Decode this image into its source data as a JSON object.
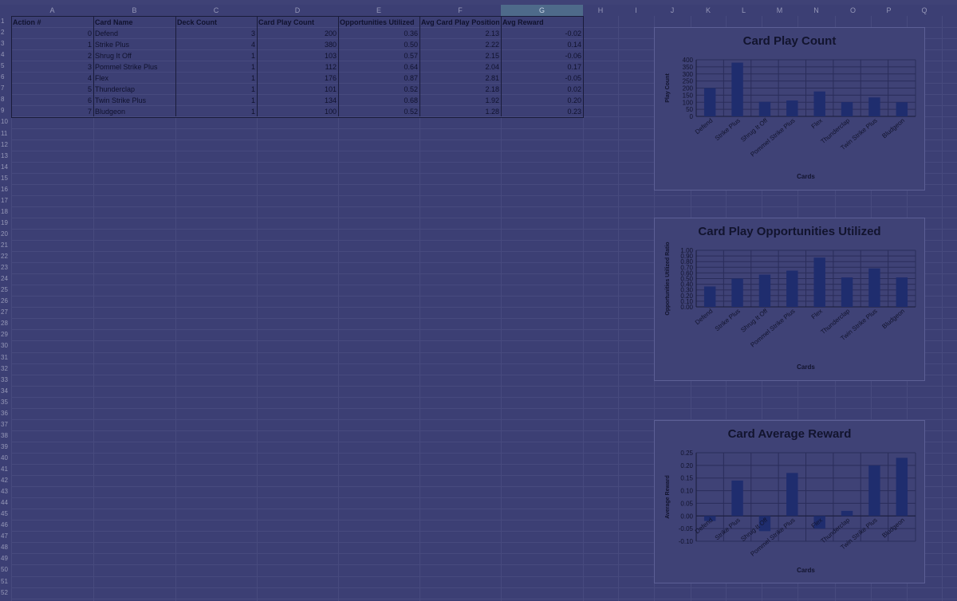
{
  "spreadsheet": {
    "columns": [
      "A",
      "B",
      "C",
      "D",
      "E",
      "F",
      "G",
      "H",
      "I",
      "J",
      "K",
      "L",
      "M",
      "N",
      "O",
      "P",
      "Q"
    ],
    "selected_column": "G",
    "rows": [
      "1",
      "2",
      "3",
      "4",
      "5",
      "6",
      "7",
      "8",
      "9",
      "10",
      "11",
      "12",
      "13",
      "14",
      "15",
      "16",
      "17",
      "18",
      "19",
      "20",
      "21",
      "22",
      "23",
      "24",
      "25",
      "26",
      "27",
      "28",
      "29",
      "30",
      "31",
      "32",
      "33",
      "34",
      "35",
      "36",
      "37",
      "38",
      "39",
      "40",
      "41",
      "42",
      "43",
      "44",
      "45",
      "46",
      "47",
      "48",
      "49",
      "50",
      "51",
      "52"
    ],
    "headers": [
      "Action #",
      "Card Name",
      "Deck Count",
      "Card Play Count",
      "Opportunities Utilized",
      "Avg Card Play Position",
      "Avg Reward"
    ],
    "data": [
      [
        "0",
        "Defend",
        "3",
        "200",
        "0.36",
        "2.13",
        "-0.02"
      ],
      [
        "1",
        "Strike Plus",
        "4",
        "380",
        "0.50",
        "2.22",
        "0.14"
      ],
      [
        "2",
        "Shrug It Off",
        "1",
        "103",
        "0.57",
        "2.15",
        "-0.06"
      ],
      [
        "3",
        "Pommel Strike Plus",
        "1",
        "112",
        "0.64",
        "2.04",
        "0.17"
      ],
      [
        "4",
        "Flex",
        "1",
        "176",
        "0.87",
        "2.81",
        "-0.05"
      ],
      [
        "5",
        "Thunderclap",
        "1",
        "101",
        "0.52",
        "2.18",
        "0.02"
      ],
      [
        "6",
        "Twin Strike Plus",
        "1",
        "134",
        "0.68",
        "1.92",
        "0.20"
      ],
      [
        "7",
        "Bludgeon",
        "1",
        "100",
        "0.52",
        "1.28",
        "0.23"
      ]
    ]
  },
  "colors": {
    "bar": "#1f2d6e",
    "axis": "#1a1c3a",
    "grid": "#2a2d5a",
    "text": "#12142e"
  },
  "chart_data": [
    {
      "type": "bar",
      "title": "Card Play Count",
      "xlabel": "Cards",
      "ylabel": "Play Count",
      "categories": [
        "Defend",
        "Strike Plus",
        "Shrug It Off",
        "Pommel Strike Plus",
        "Flex",
        "Thunderclap",
        "Twin Strike Plus",
        "Bludgeon"
      ],
      "values": [
        200,
        380,
        103,
        112,
        176,
        101,
        134,
        100
      ],
      "ylim": [
        0,
        400
      ],
      "yticks": [
        "0",
        "50",
        "100",
        "150",
        "200",
        "250",
        "300",
        "350",
        "400"
      ],
      "grid": true,
      "legend": "none"
    },
    {
      "type": "bar",
      "title": "Card Play Opportunities Utilized",
      "xlabel": "Cards",
      "ylabel": "Opportunities Utilized Ratio",
      "categories": [
        "Defend",
        "Strike Plus",
        "Shrug It Off",
        "Pommel Strike Plus",
        "Flex",
        "Thunderclap",
        "Twin Strike Plus",
        "Bludgeon"
      ],
      "values": [
        0.36,
        0.5,
        0.57,
        0.64,
        0.87,
        0.52,
        0.68,
        0.52
      ],
      "ylim": [
        0,
        1
      ],
      "yticks": [
        "0.00",
        "0.10",
        "0.20",
        "0.30",
        "0.40",
        "0.50",
        "0.60",
        "0.70",
        "0.80",
        "0.90",
        "1.00"
      ],
      "grid": true,
      "legend": "none"
    },
    {
      "type": "bar",
      "title": "Card Average Reward",
      "xlabel": "Cards",
      "ylabel": "Average Reward",
      "categories": [
        "Defend",
        "Strike Plus",
        "Shrug It Off",
        "Pommel Strike Plus",
        "Flex",
        "Thunderclap",
        "Twin Strike Plus",
        "Bludgeon"
      ],
      "values": [
        -0.02,
        0.14,
        -0.06,
        0.17,
        -0.05,
        0.02,
        0.2,
        0.23
      ],
      "ylim": [
        -0.1,
        0.25
      ],
      "yticks": [
        "-0.10",
        "-0.05",
        "0.00",
        "0.05",
        "0.10",
        "0.15",
        "0.20",
        "0.25"
      ],
      "grid": true,
      "legend": "none"
    }
  ]
}
